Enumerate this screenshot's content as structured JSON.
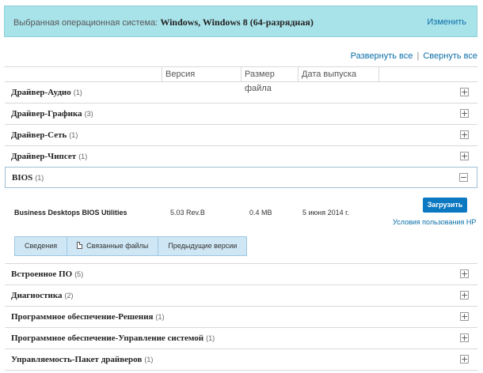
{
  "banner": {
    "label": "Выбранная операционная система:",
    "os": "Windows, Windows 8 (64-разрядная)",
    "change": "Изменить"
  },
  "links": {
    "expand_all": "Развернуть все",
    "separator": "|",
    "collapse_all": "Свернуть все"
  },
  "columns": {
    "version": "Версия",
    "size": "Размер файла",
    "date": "Дата выпуска"
  },
  "categories": [
    {
      "title": "Драйвер-Аудио",
      "count": "(1)",
      "toggle": "+"
    },
    {
      "title": "Драйвер-Графика",
      "count": "(3)",
      "toggle": "+"
    },
    {
      "title": "Драйвер-Сеть",
      "count": "(1)",
      "toggle": "+"
    },
    {
      "title": "Драйвер-Чипсет",
      "count": "(1)",
      "toggle": "+"
    },
    {
      "title": "BIOS",
      "count": "(1)",
      "toggle": "−"
    },
    {
      "title": "Встроенное ПО",
      "count": "(5)",
      "toggle": "+"
    },
    {
      "title": "Диагностика",
      "count": "(2)",
      "toggle": "+"
    },
    {
      "title": "Программное обеспечение-Решения",
      "count": "(1)",
      "toggle": "+"
    },
    {
      "title": "Программное обеспечение-Управление системой",
      "count": "(1)",
      "toggle": "+"
    },
    {
      "title": "Управляемость-Пакет драйверов",
      "count": "(1)",
      "toggle": "+"
    }
  ],
  "bios_item": {
    "name": "Business Desktops BIOS Utilities",
    "version": "5.03 Rev.B",
    "size": "0.4 MB",
    "date": "5 июня 2014 г.",
    "download": "Загрузить",
    "terms": "Условия пользования HP"
  },
  "tabs": [
    "Сведения",
    "Связанные файлы",
    "Предыдущие версии"
  ]
}
